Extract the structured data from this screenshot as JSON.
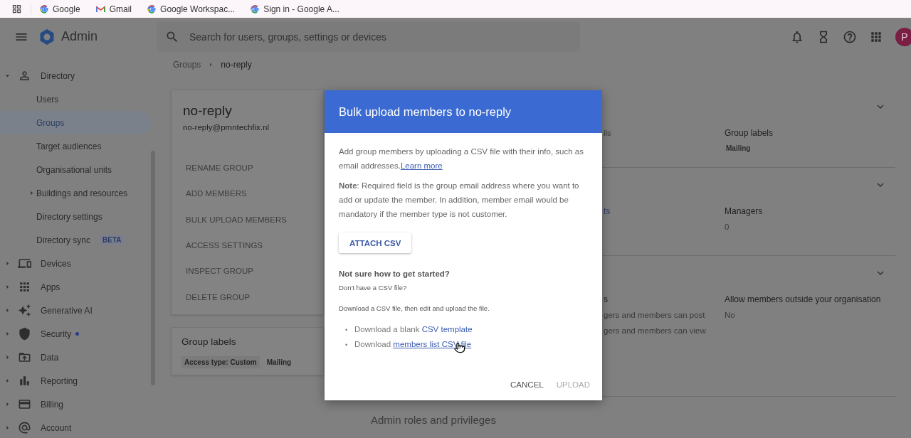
{
  "bookmarks": [
    {
      "label": "Google",
      "kind": "google"
    },
    {
      "label": "Gmail",
      "kind": "gmail"
    },
    {
      "label": "Google Workspac...",
      "kind": "google"
    },
    {
      "label": "Sign in - Google A...",
      "kind": "google"
    }
  ],
  "header": {
    "product": "Admin",
    "search": {
      "placeholder": "Search for users, groups, settings or devices"
    },
    "avatar": "P"
  },
  "sidebar": {
    "items": [
      {
        "label": "Directory",
        "expanded": true,
        "selected": false,
        "dot": false,
        "children": [
          {
            "label": "Users",
            "selected": false
          },
          {
            "label": "Groups",
            "selected": true
          },
          {
            "label": "Target audiences",
            "selected": false
          },
          {
            "label": "Organisational units",
            "selected": false
          },
          {
            "label": "Buildings and resources",
            "selected": false,
            "expanded": false
          },
          {
            "label": "Directory settings",
            "selected": false
          },
          {
            "label": "Directory sync",
            "selected": false,
            "badge": "BETA"
          }
        ]
      },
      {
        "label": "Devices",
        "expanded": false,
        "selected": false,
        "dot": false
      },
      {
        "label": "Apps",
        "expanded": false,
        "selected": false,
        "dot": false
      },
      {
        "label": "Generative AI",
        "expanded": false,
        "selected": false,
        "dot": false
      },
      {
        "label": "Security",
        "expanded": false,
        "selected": false,
        "dot": true
      },
      {
        "label": "Data",
        "expanded": false,
        "selected": false,
        "dot": false
      },
      {
        "label": "Reporting",
        "expanded": false,
        "selected": false,
        "dot": false
      },
      {
        "label": "Billing",
        "expanded": false,
        "selected": false,
        "dot": false
      },
      {
        "label": "Account",
        "expanded": false,
        "selected": false,
        "dot": false
      }
    ]
  },
  "breadcrumb": [
    "Groups",
    "no-reply"
  ],
  "group_card": {
    "name": "no-reply",
    "email": "no-reply@pmntechfix.nl",
    "actions": [
      "RENAME GROUP",
      "ADD MEMBERS",
      "BULK UPLOAD MEMBERS",
      "ACCESS SETTINGS",
      "INSPECT GROUP",
      "DELETE GROUP"
    ]
  },
  "labels_card": {
    "title": "Group labels",
    "labels": [
      "Access type: Custom",
      "Mailing"
    ]
  },
  "sections": [
    {
      "left": [
        {
          "text": "ils",
          "kind": "value"
        }
      ],
      "label": "Group labels",
      "value": {
        "text": "Mailing",
        "kind": "tag"
      }
    },
    {
      "left": [
        {
          "text": "ts",
          "kind": "link"
        }
      ],
      "label": "Managers",
      "value": {
        "text": "0",
        "kind": "value"
      }
    },
    {
      "left": [
        {
          "text": "s",
          "kind": "label"
        },
        {
          "text": "gers and members can post",
          "kind": "value"
        },
        {
          "text": "gers and members can view",
          "kind": "value"
        }
      ],
      "label": "Allow members outside your organisation",
      "value": {
        "text": "No",
        "kind": "value"
      }
    }
  ],
  "next_heading": "Admin roles and privileges",
  "dialog": {
    "title": "Bulk upload members to no-reply",
    "intro": "Add group members by uploading a CSV file with their info, such as email addresses.",
    "intro_link": "Learn more",
    "note": "**Note**: Required field is the group email address where you want to add or update the member. In addition, member email would be mandatory if the member type is not customer.",
    "attach_button": "ATTACH CSV",
    "help_heading": "Not sure how to get started?",
    "help_question": "Don't have a CSV file?",
    "help_text": "Download a CSV file, then edit and upload the file.",
    "downloads": [
      {
        "marker": "•",
        "text": "Download a blank ",
        "link": "CSV template",
        "underlined": false
      },
      {
        "marker": "•",
        "text": "Download ",
        "link": "members list CSV file",
        "underlined": true
      }
    ],
    "actions": [
      {
        "label": "CANCEL",
        "disabled": false
      },
      {
        "label": "UPLOAD",
        "disabled": true
      }
    ]
  }
}
